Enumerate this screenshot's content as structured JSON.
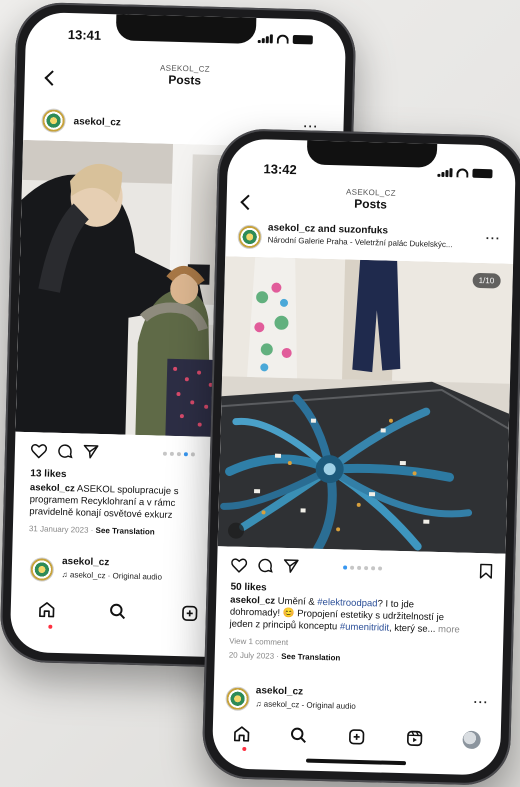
{
  "back_phone": {
    "status_time": "13:41",
    "header_account": "ASEKOL_CZ",
    "header_title": "Posts",
    "post_user": "asekol_cz",
    "likes": "13 likes",
    "caption_user": "asekol_cz",
    "caption_lines": [
      "ASEKOL spolupracuje s",
      "programem Recyklohraní a v rámc",
      "pravidelně konají osvětové exkurz"
    ],
    "date": "31 January 2023",
    "see_translation": "See Translation",
    "next_post_user": "asekol_cz",
    "next_post_audio": "asekol_cz · Original audio"
  },
  "front_phone": {
    "status_time": "13:42",
    "header_account": "ASEKOL_CZ",
    "header_title": "Posts",
    "post_user": "asekol_cz and suzonfuks",
    "post_location": "Národní Galerie Praha - Veletržní palác Dukelskýc...",
    "carousel_counter": "1/10",
    "likes": "50 likes",
    "caption_user": "asekol_cz",
    "caption_line1_a": "Umění & ",
    "caption_hashtag1": "#elektroodpad",
    "caption_line1_b": "? I to jde",
    "caption_line2_a": "dohromady! ",
    "caption_emoji": "😊",
    "caption_line2_b": " Propojení estetiky s udržitelností je",
    "caption_line3_a": "jeden z principů konceptu ",
    "caption_hashtag2": "#umenitridit",
    "caption_line3_b": ", který se...",
    "caption_more": " more",
    "view_comments": "View 1 comment",
    "date": "20 July 2023",
    "see_translation": "See Translation",
    "next_post_user": "asekol_cz",
    "next_post_audio": "asekol_cz - Original audio"
  },
  "colors": {
    "accent_blue": "#3897f0",
    "hashtag": "#2b4f98",
    "notification_dot": "#ff3040"
  },
  "icons": [
    "back-icon",
    "more-icon",
    "heart-icon",
    "comment-icon",
    "share-icon",
    "bookmark-icon",
    "home-icon",
    "search-icon",
    "add-icon",
    "reels-icon",
    "profile-icon",
    "music-icon",
    "tag-icon"
  ]
}
